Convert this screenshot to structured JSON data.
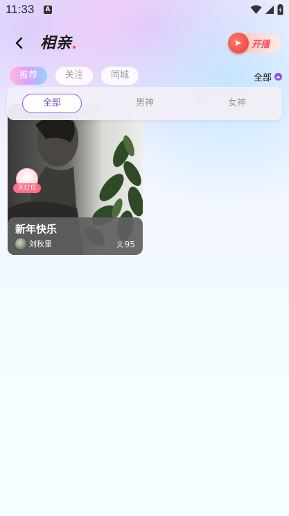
{
  "status_bar": {
    "time": "11:33",
    "notification_letter": "A"
  },
  "header": {
    "title": "相亲",
    "live_button_label": "开播"
  },
  "tabs": [
    {
      "label": "推荐",
      "active": true
    },
    {
      "label": "关注",
      "active": false
    },
    {
      "label": "同城",
      "active": false
    }
  ],
  "filter": {
    "label": "全部"
  },
  "dropdown": {
    "options": [
      {
        "label": "全部",
        "selected": true
      },
      {
        "label": "男神",
        "selected": false
      },
      {
        "label": "女神",
        "selected": false
      }
    ]
  },
  "cards": [
    {
      "title": "新年快乐",
      "host": "刘秋里",
      "viewers": "95",
      "badge": "天灯位"
    }
  ],
  "colors": {
    "accent": "#7a48d0",
    "live": "#ff4a5a",
    "badge": "#ff6e86"
  }
}
